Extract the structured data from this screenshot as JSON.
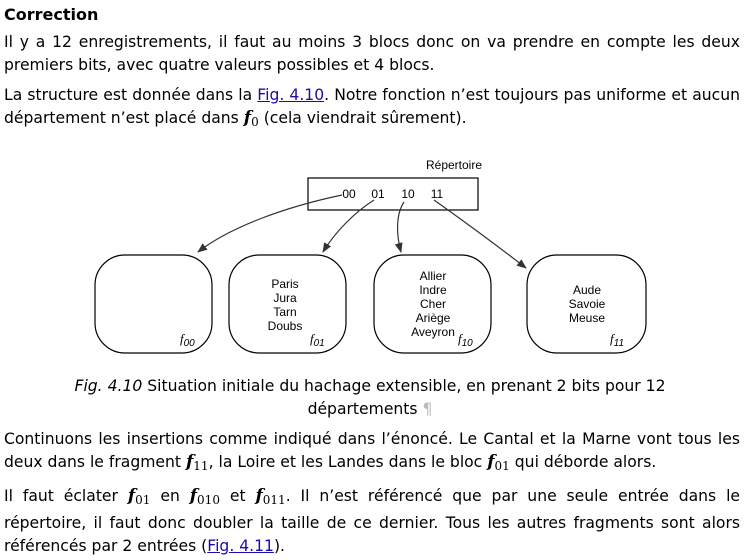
{
  "heading": "Correction",
  "para1": "Il y a 12 enregistrements, il faut au moins 3 blocs donc on va prendre en compte les deux premiers bits, avec quatre valeurs possibles et 4 blocs.",
  "para2": {
    "before": "La structure est donnée dans la ",
    "link": "Fig. 4.10",
    "middle": ". Notre fonction n’est toujours pas uniforme et aucun département n’est placé dans ",
    "f_sym": "f",
    "f_sub": "0",
    "after": " (cela viendrait sûrement)."
  },
  "figure": {
    "directory_label": "Répertoire",
    "entries": [
      "00",
      "01",
      "10",
      "11"
    ],
    "buckets": [
      {
        "items": [],
        "label": "f",
        "sub": "00"
      },
      {
        "items": [
          "Paris",
          "Jura",
          "Tarn",
          "Doubs"
        ],
        "label": "f",
        "sub": "01"
      },
      {
        "items": [
          "Allier",
          "Indre",
          "Cher",
          "Ariège",
          "Aveyron"
        ],
        "label": "f",
        "sub": "10"
      },
      {
        "items": [
          "Aude",
          "Savoie",
          "Meuse"
        ],
        "label": "f",
        "sub": "11"
      }
    ]
  },
  "caption": {
    "fignum": "Fig. 4.10",
    "text": " Situation initiale du hachage extensible, en prenant 2 bits pour 12 départements ",
    "pilcrow": "¶"
  },
  "para3": {
    "before": "Continuons les insertions comme indiqué dans l’énoncé. Le Cantal et la Marne vont tous les deux dans le fragment ",
    "f1_sym": "f",
    "f1_sub": "11",
    "middle": ", la Loire et les Landes dans le bloc ",
    "f2_sym": "f",
    "f2_sub": "01",
    "after": " qui déborde alors."
  },
  "para4": {
    "t1": "Il faut éclater ",
    "a_sym": "f",
    "a_sub": "01",
    "t2": " en ",
    "b_sym": "f",
    "b_sub": "010",
    "t3": " et ",
    "c_sym": "f",
    "c_sub": "011",
    "t4": ". Il n’est référencé que par une seule entrée dans le répertoire, il faut donc doubler la taille de ce dernier. Tous les autres fragments sont alors référencés par 2 entrées (",
    "link": "Fig. 4.11",
    "t5": ")."
  }
}
